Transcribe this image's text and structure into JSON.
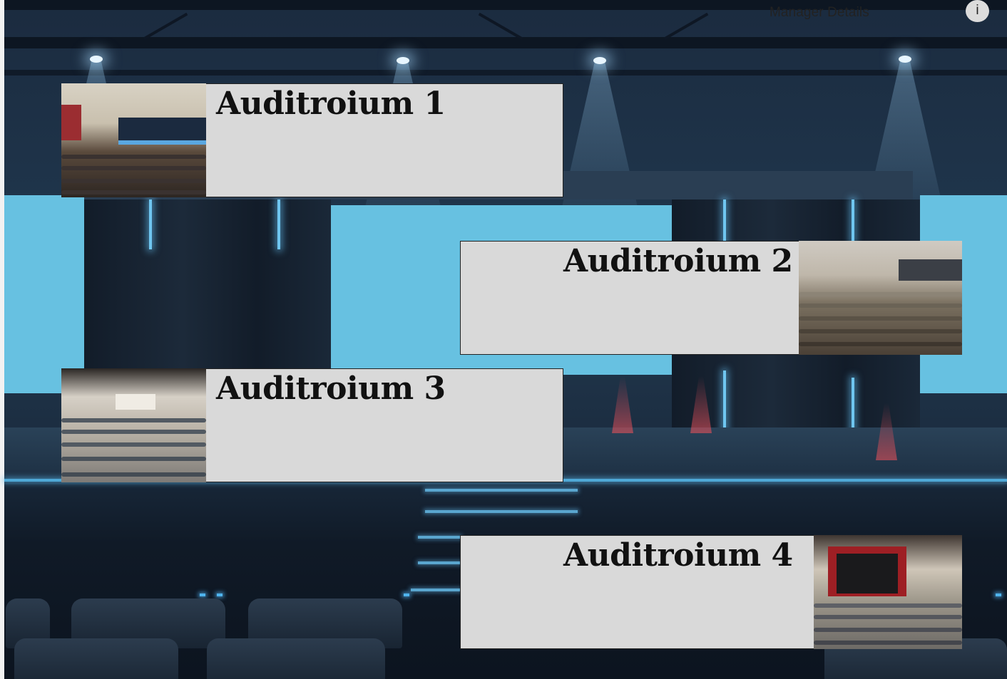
{
  "header": {
    "manager_link": "Manager Details",
    "info_label": "i"
  },
  "auditoriums": [
    {
      "title": "Auditroium 1",
      "image_icon": "auditorium-photo"
    },
    {
      "title": "Auditroium 2",
      "image_icon": "auditorium-photo"
    },
    {
      "title": "Auditroium 3",
      "image_icon": "auditorium-photo"
    },
    {
      "title": "Auditroium 4",
      "image_icon": "auditorium-photo"
    }
  ],
  "colors": {
    "card_bg": "#d9d9d9",
    "screen_blue": "#67c1e1",
    "stage_dark": "#1a2b3e"
  }
}
